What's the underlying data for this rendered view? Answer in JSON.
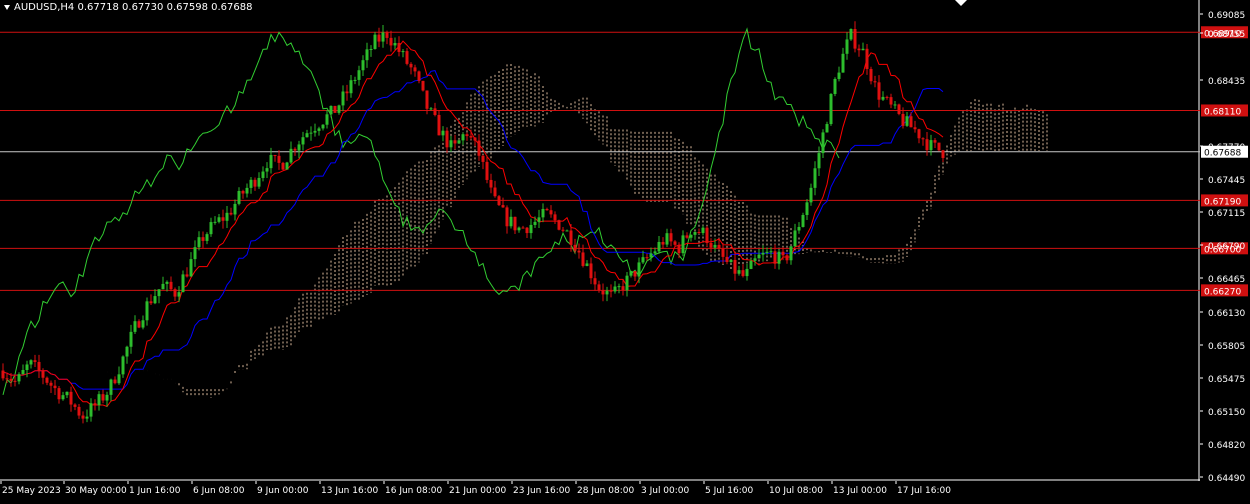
{
  "header": {
    "symbol": "AUDUSD,H4",
    "open": "0.67718",
    "high": "0.67730",
    "low": "0.67598",
    "close": "0.67688"
  },
  "colors": {
    "background": "#000000",
    "bull_candle": "#2dbd2d",
    "bear_candle": "#e01010",
    "tenkan": "#ff0000",
    "kijun": "#0000ff",
    "chikou": "#32cd32",
    "cloud": "#f5d0b0",
    "level_line": "#d01010",
    "current_price_line": "#c8c8c8",
    "axis_text": "#ffffff"
  },
  "price_scale": {
    "ticks": [
      "0.69085",
      "0.68755",
      "0.68435",
      "0.67770",
      "0.67445",
      "0.67115",
      "0.66790",
      "0.66465",
      "0.66130",
      "0.65805",
      "0.65475",
      "0.65150",
      "0.64820",
      "0.64490"
    ]
  },
  "levels": [
    {
      "price": 0.6891,
      "label": "0.68910"
    },
    {
      "price": 0.6811,
      "label": "0.68110"
    },
    {
      "price": 0.6719,
      "label": "0.67190"
    },
    {
      "price": 0.667,
      "label": "0.66700"
    },
    {
      "price": 0.6627,
      "label": "0.66270"
    }
  ],
  "current_price": {
    "price": 0.67688,
    "label": "0.67688"
  },
  "time_scale": {
    "labels": [
      "25 May 2023",
      "30 May 00:00",
      "1 Jun 16:00",
      "6 Jun 08:00",
      "9 Jun 00:00",
      "13 Jun 16:00",
      "16 Jun 08:00",
      "21 Jun 00:00",
      "23 Jun 16:00",
      "28 Jun 08:00",
      "3 Jul 00:00",
      "5 Jul 16:00",
      "10 Jul 08:00",
      "13 Jul 00:00",
      "17 Jul 16:00"
    ]
  },
  "chart_data": {
    "type": "candlestick",
    "price_range": [
      0.6432,
      0.6924
    ],
    "close_path": [
      0.6545,
      0.6532,
      0.6552,
      0.654,
      0.6525,
      0.6515,
      0.6498,
      0.651,
      0.6525,
      0.6555,
      0.659,
      0.6615,
      0.6632,
      0.6625,
      0.665,
      0.668,
      0.6695,
      0.6705,
      0.6725,
      0.674,
      0.676,
      0.6755,
      0.6775,
      0.679,
      0.68,
      0.681,
      0.683,
      0.6855,
      0.688,
      0.689,
      0.687,
      0.685,
      0.6815,
      0.679,
      0.677,
      0.679,
      0.6765,
      0.672,
      0.67,
      0.669,
      0.6695,
      0.6705,
      0.6695,
      0.668,
      0.6655,
      0.663,
      0.662,
      0.6635,
      0.665,
      0.6665,
      0.668,
      0.667,
      0.669,
      0.6685,
      0.6665,
      0.665,
      0.664,
      0.666,
      0.6665,
      0.6655,
      0.669,
      0.673,
      0.679,
      0.685,
      0.6888,
      0.687,
      0.683,
      0.6815,
      0.68,
      0.679,
      0.6775,
      0.6769
    ]
  }
}
